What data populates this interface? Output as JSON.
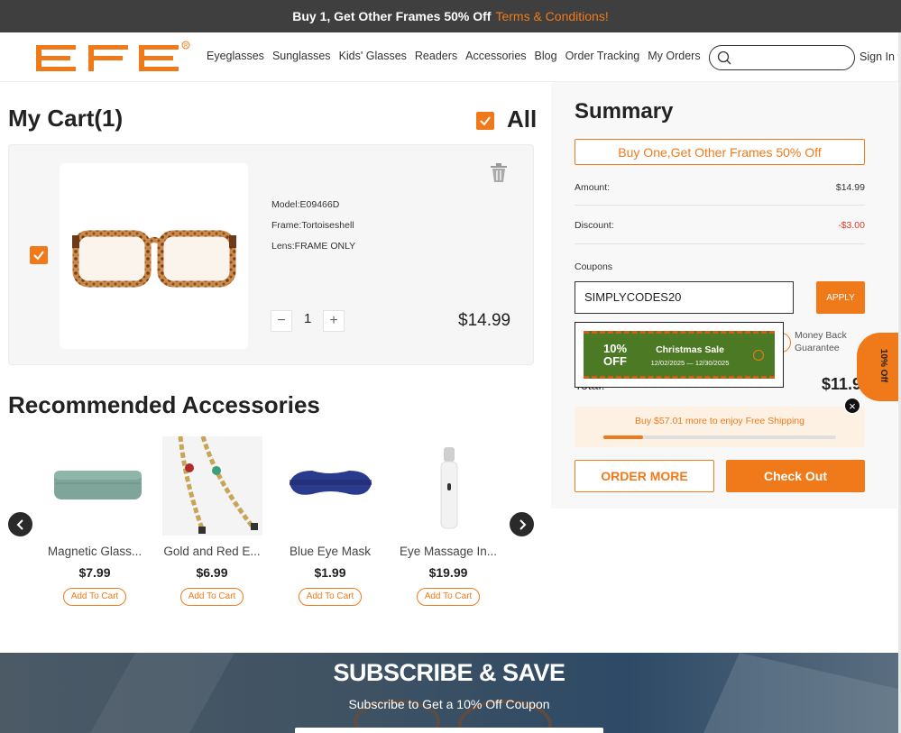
{
  "promo": {
    "text": "Buy 1, Get Other Frames 50% Off",
    "link": "Terms & Conditions!"
  },
  "header": {
    "brand": "EFE",
    "nav": [
      "Eyeglasses",
      "Sunglasses",
      "Kids' Glasses",
      "Readers",
      "Accessories",
      "Blog",
      "Order Tracking",
      "My Orders"
    ],
    "search_placeholder": "",
    "sign_in": "Sign In"
  },
  "cart": {
    "title": "My Cart(1)",
    "all_label": "All",
    "item": {
      "model": "Model:E09466D",
      "frame": "Frame:Tortoiseshell",
      "lens": "Lens:FRAME ONLY",
      "qty": "1",
      "price": "$14.99"
    }
  },
  "recommended": {
    "title": "Recommended Accessories",
    "items": [
      {
        "name": "Magnetic Glass...",
        "price": "$7.99",
        "button": "Add To Cart",
        "icon": "glasses-case-icon"
      },
      {
        "name": "Gold and Red E...",
        "price": "$6.99",
        "button": "Add To Cart",
        "icon": "chain-icon"
      },
      {
        "name": "Blue Eye Mask",
        "price": "$1.99",
        "button": "Add To Cart",
        "icon": "eye-mask-icon"
      },
      {
        "name": "Eye Massage In...",
        "price": "$19.99",
        "button": "Add To Cart",
        "icon": "massager-icon"
      }
    ]
  },
  "summary": {
    "title": "Summary",
    "bogo": "Buy One,Get Other Frames 50% Off",
    "amount_label": "Amount:",
    "amount": "$14.99",
    "discount_label": "Discount:",
    "discount": "-$3.00",
    "coupons_label": "Coupons",
    "coupon_code": "SIMPLYCODES20",
    "apply": "APPLY",
    "guarantee": [
      "Money Back",
      "Guarantee"
    ],
    "total_label": "Total:",
    "total": "$11.9",
    "shipping_text": "Buy $57.01 more to enjoy Free Shipping",
    "shipping_progress": 0.17,
    "order_more": "ORDER MORE",
    "checkout": "Check Out"
  },
  "coupon_popup": {
    "pct": "10%",
    "off": "OFF",
    "name": "Christmas Sale",
    "dates": "12/02/2025 — 12/30/2025"
  },
  "side_tab": "10% Off",
  "close_symbol": "×",
  "subscribe": {
    "title": "SUBSCRIBE & SAVE",
    "subtitle": "Subscribe to Get a 10% Off Coupon"
  },
  "colors": {
    "accent": "#f07a1a",
    "promo_bg": "#3f3f3f",
    "coupon_green": "#4c7a24",
    "discount_red": "#e03a2a"
  }
}
